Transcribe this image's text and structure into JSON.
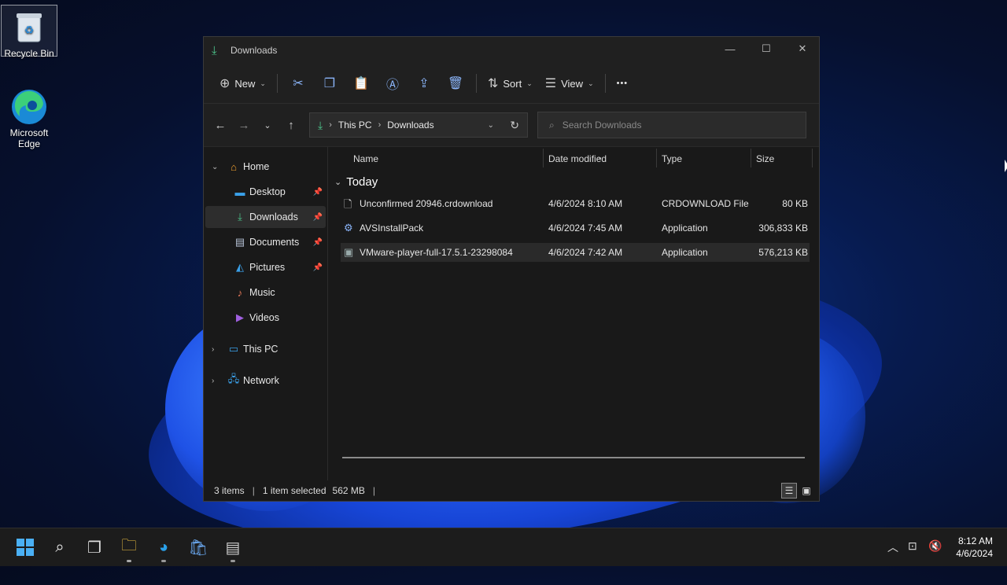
{
  "desktop": {
    "icons": [
      {
        "label": "Recycle Bin",
        "icon": "recycle-bin-icon"
      },
      {
        "label": "Microsoft Edge",
        "icon": "edge-icon"
      }
    ]
  },
  "window": {
    "title": "Downloads",
    "controls": {
      "minimize": "—",
      "maximize": "☐",
      "close": "✕"
    }
  },
  "toolbar": {
    "new_label": "New",
    "sort_label": "Sort",
    "view_label": "View",
    "more_label": "•••"
  },
  "address": {
    "crumbs": [
      "This PC",
      "Downloads"
    ],
    "search_placeholder": "Search Downloads"
  },
  "nav": {
    "items": [
      {
        "label": "Home",
        "icon": "home-icon"
      },
      {
        "label": "Desktop",
        "icon": "desktop-icon",
        "pinned": true
      },
      {
        "label": "Downloads",
        "icon": "downloads-icon",
        "pinned": true,
        "selected": true
      },
      {
        "label": "Documents",
        "icon": "documents-icon",
        "pinned": true
      },
      {
        "label": "Pictures",
        "icon": "pictures-icon",
        "pinned": true
      },
      {
        "label": "Music",
        "icon": "music-icon"
      },
      {
        "label": "Videos",
        "icon": "videos-icon"
      },
      {
        "label": "This PC",
        "icon": "this-pc-icon"
      },
      {
        "label": "Network",
        "icon": "network-icon"
      }
    ]
  },
  "files": {
    "columns": [
      "Name",
      "Date modified",
      "Type",
      "Size"
    ],
    "group": "Today",
    "rows": [
      {
        "name": "Unconfirmed 20946.crdownload",
        "date": "4/6/2024 8:10 AM",
        "type": "CRDOWNLOAD File",
        "size": "80 KB"
      },
      {
        "name": "AVSInstallPack",
        "date": "4/6/2024 7:45 AM",
        "type": "Application",
        "size": "306,833 KB"
      },
      {
        "name": "VMware-player-full-17.5.1-23298084",
        "date": "4/6/2024 7:42 AM",
        "type": "Application",
        "size": "576,213 KB",
        "selected": true
      }
    ]
  },
  "status": {
    "count": "3 items",
    "selection": "1 item selected",
    "size": "562 MB"
  },
  "taskbar": {
    "time": "8:12 AM",
    "date": "4/6/2024"
  }
}
